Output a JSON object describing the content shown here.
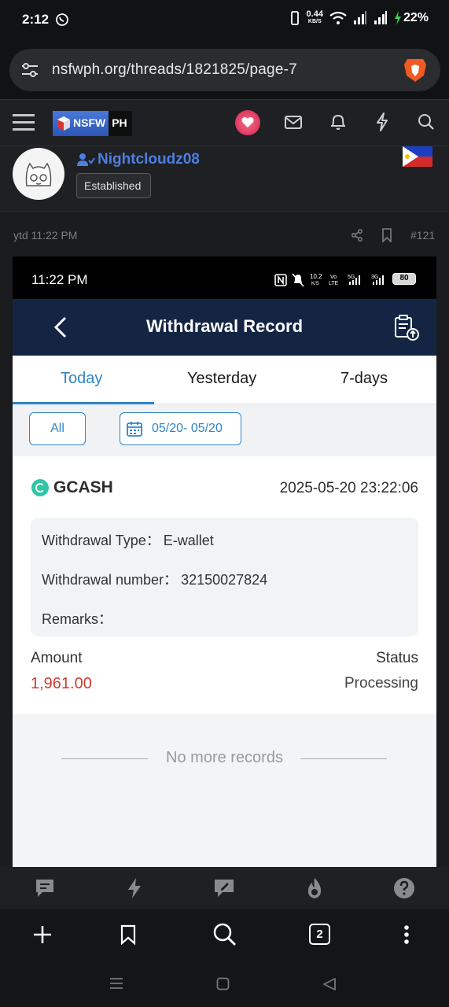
{
  "status_bar": {
    "time": "2:12",
    "speed_value": "0.44",
    "speed_unit": "KB/S",
    "battery": "22%"
  },
  "browser": {
    "url": "nsfwph.org/threads/1821825/page-7",
    "tab_count": "2"
  },
  "forum": {
    "logo_left": "NSFW",
    "logo_right": "PH",
    "user": {
      "name": "Nightcloudz08",
      "rank": "Established"
    },
    "post": {
      "time": "ytd 11:22 PM",
      "number": "#121"
    }
  },
  "screenshot": {
    "status_time": "11:22 PM",
    "battery": "80",
    "title": "Withdrawal Record",
    "tabs": [
      "Today",
      "Yesterday",
      "7-days"
    ],
    "active_tab": "Today",
    "filter_all": "All",
    "filter_date": "05/20- 05/20",
    "record": {
      "provider": "GCASH",
      "datetime": "2025-05-20 23:22:06",
      "type_label": "Withdrawal Type：",
      "type_value": "E-wallet",
      "number_label": "Withdrawal number：",
      "number_value": "32150027824",
      "remarks_label": "Remarks：",
      "amount_label": "Amount",
      "amount_value": "1,961.00",
      "status_label": "Status",
      "status_value": "Processing"
    },
    "footer": "No more records"
  },
  "colors": {
    "forum_bg": "#1f2023",
    "link_blue": "#4d7fe0",
    "app_navy": "#142544",
    "accent_blue": "#2f86c9",
    "amount_red": "#d23b2f"
  }
}
